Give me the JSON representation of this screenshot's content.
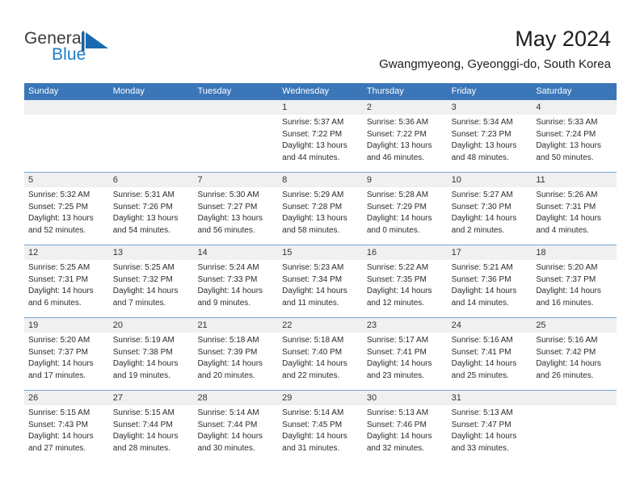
{
  "brand": {
    "name_part1": "General",
    "name_part2": "Blue",
    "logo_icon": "blue-flag-triangle-icon",
    "color_primary": "#1a7ec8",
    "color_text": "#3b3b3b"
  },
  "header": {
    "title": "May 2024",
    "subtitle": "Gwangmyeong, Gyeonggi-do, South Korea"
  },
  "calendar": {
    "header_background": "#3a76b8",
    "daynumber_background": "#f0f0f0",
    "weekdays": [
      "Sunday",
      "Monday",
      "Tuesday",
      "Wednesday",
      "Thursday",
      "Friday",
      "Saturday"
    ],
    "weeks": [
      [
        {
          "day": "",
          "sunrise": "",
          "sunset": "",
          "daylight": ""
        },
        {
          "day": "",
          "sunrise": "",
          "sunset": "",
          "daylight": ""
        },
        {
          "day": "",
          "sunrise": "",
          "sunset": "",
          "daylight": ""
        },
        {
          "day": "1",
          "sunrise": "Sunrise: 5:37 AM",
          "sunset": "Sunset: 7:22 PM",
          "daylight": "Daylight: 13 hours and 44 minutes."
        },
        {
          "day": "2",
          "sunrise": "Sunrise: 5:36 AM",
          "sunset": "Sunset: 7:22 PM",
          "daylight": "Daylight: 13 hours and 46 minutes."
        },
        {
          "day": "3",
          "sunrise": "Sunrise: 5:34 AM",
          "sunset": "Sunset: 7:23 PM",
          "daylight": "Daylight: 13 hours and 48 minutes."
        },
        {
          "day": "4",
          "sunrise": "Sunrise: 5:33 AM",
          "sunset": "Sunset: 7:24 PM",
          "daylight": "Daylight: 13 hours and 50 minutes."
        }
      ],
      [
        {
          "day": "5",
          "sunrise": "Sunrise: 5:32 AM",
          "sunset": "Sunset: 7:25 PM",
          "daylight": "Daylight: 13 hours and 52 minutes."
        },
        {
          "day": "6",
          "sunrise": "Sunrise: 5:31 AM",
          "sunset": "Sunset: 7:26 PM",
          "daylight": "Daylight: 13 hours and 54 minutes."
        },
        {
          "day": "7",
          "sunrise": "Sunrise: 5:30 AM",
          "sunset": "Sunset: 7:27 PM",
          "daylight": "Daylight: 13 hours and 56 minutes."
        },
        {
          "day": "8",
          "sunrise": "Sunrise: 5:29 AM",
          "sunset": "Sunset: 7:28 PM",
          "daylight": "Daylight: 13 hours and 58 minutes."
        },
        {
          "day": "9",
          "sunrise": "Sunrise: 5:28 AM",
          "sunset": "Sunset: 7:29 PM",
          "daylight": "Daylight: 14 hours and 0 minutes."
        },
        {
          "day": "10",
          "sunrise": "Sunrise: 5:27 AM",
          "sunset": "Sunset: 7:30 PM",
          "daylight": "Daylight: 14 hours and 2 minutes."
        },
        {
          "day": "11",
          "sunrise": "Sunrise: 5:26 AM",
          "sunset": "Sunset: 7:31 PM",
          "daylight": "Daylight: 14 hours and 4 minutes."
        }
      ],
      [
        {
          "day": "12",
          "sunrise": "Sunrise: 5:25 AM",
          "sunset": "Sunset: 7:31 PM",
          "daylight": "Daylight: 14 hours and 6 minutes."
        },
        {
          "day": "13",
          "sunrise": "Sunrise: 5:25 AM",
          "sunset": "Sunset: 7:32 PM",
          "daylight": "Daylight: 14 hours and 7 minutes."
        },
        {
          "day": "14",
          "sunrise": "Sunrise: 5:24 AM",
          "sunset": "Sunset: 7:33 PM",
          "daylight": "Daylight: 14 hours and 9 minutes."
        },
        {
          "day": "15",
          "sunrise": "Sunrise: 5:23 AM",
          "sunset": "Sunset: 7:34 PM",
          "daylight": "Daylight: 14 hours and 11 minutes."
        },
        {
          "day": "16",
          "sunrise": "Sunrise: 5:22 AM",
          "sunset": "Sunset: 7:35 PM",
          "daylight": "Daylight: 14 hours and 12 minutes."
        },
        {
          "day": "17",
          "sunrise": "Sunrise: 5:21 AM",
          "sunset": "Sunset: 7:36 PM",
          "daylight": "Daylight: 14 hours and 14 minutes."
        },
        {
          "day": "18",
          "sunrise": "Sunrise: 5:20 AM",
          "sunset": "Sunset: 7:37 PM",
          "daylight": "Daylight: 14 hours and 16 minutes."
        }
      ],
      [
        {
          "day": "19",
          "sunrise": "Sunrise: 5:20 AM",
          "sunset": "Sunset: 7:37 PM",
          "daylight": "Daylight: 14 hours and 17 minutes."
        },
        {
          "day": "20",
          "sunrise": "Sunrise: 5:19 AM",
          "sunset": "Sunset: 7:38 PM",
          "daylight": "Daylight: 14 hours and 19 minutes."
        },
        {
          "day": "21",
          "sunrise": "Sunrise: 5:18 AM",
          "sunset": "Sunset: 7:39 PM",
          "daylight": "Daylight: 14 hours and 20 minutes."
        },
        {
          "day": "22",
          "sunrise": "Sunrise: 5:18 AM",
          "sunset": "Sunset: 7:40 PM",
          "daylight": "Daylight: 14 hours and 22 minutes."
        },
        {
          "day": "23",
          "sunrise": "Sunrise: 5:17 AM",
          "sunset": "Sunset: 7:41 PM",
          "daylight": "Daylight: 14 hours and 23 minutes."
        },
        {
          "day": "24",
          "sunrise": "Sunrise: 5:16 AM",
          "sunset": "Sunset: 7:41 PM",
          "daylight": "Daylight: 14 hours and 25 minutes."
        },
        {
          "day": "25",
          "sunrise": "Sunrise: 5:16 AM",
          "sunset": "Sunset: 7:42 PM",
          "daylight": "Daylight: 14 hours and 26 minutes."
        }
      ],
      [
        {
          "day": "26",
          "sunrise": "Sunrise: 5:15 AM",
          "sunset": "Sunset: 7:43 PM",
          "daylight": "Daylight: 14 hours and 27 minutes."
        },
        {
          "day": "27",
          "sunrise": "Sunrise: 5:15 AM",
          "sunset": "Sunset: 7:44 PM",
          "daylight": "Daylight: 14 hours and 28 minutes."
        },
        {
          "day": "28",
          "sunrise": "Sunrise: 5:14 AM",
          "sunset": "Sunset: 7:44 PM",
          "daylight": "Daylight: 14 hours and 30 minutes."
        },
        {
          "day": "29",
          "sunrise": "Sunrise: 5:14 AM",
          "sunset": "Sunset: 7:45 PM",
          "daylight": "Daylight: 14 hours and 31 minutes."
        },
        {
          "day": "30",
          "sunrise": "Sunrise: 5:13 AM",
          "sunset": "Sunset: 7:46 PM",
          "daylight": "Daylight: 14 hours and 32 minutes."
        },
        {
          "day": "31",
          "sunrise": "Sunrise: 5:13 AM",
          "sunset": "Sunset: 7:47 PM",
          "daylight": "Daylight: 14 hours and 33 minutes."
        },
        {
          "day": "",
          "sunrise": "",
          "sunset": "",
          "daylight": ""
        }
      ]
    ]
  }
}
